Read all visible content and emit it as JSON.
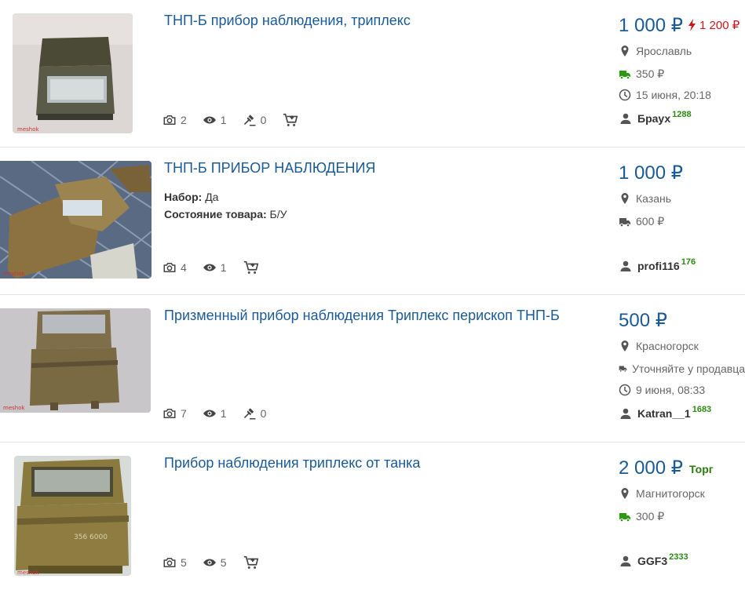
{
  "colors": {
    "link": "#1a5a96",
    "blitz": "#c8161d",
    "rating": "#2b8a10",
    "delivery_green": "#2b9a10"
  },
  "listings": [
    {
      "title": "ТНП-Б прибор наблюдения, триплекс",
      "price": "1 000 ₽",
      "blitz_price": "1 200 ₽",
      "torg": "",
      "props": [],
      "photos": "2",
      "views": "1",
      "bids": "0",
      "has_bids": true,
      "has_cart": true,
      "city": "Ярославль",
      "delivery": "350 ₽",
      "delivery_colored": true,
      "date": "15 июня, 20:18",
      "seller": "Браух",
      "rating": "1288"
    },
    {
      "title": "ТНП-Б ПРИБОР НАБЛЮДЕНИЯ",
      "price": "1 000 ₽",
      "blitz_price": "",
      "torg": "",
      "props": [
        {
          "label": "Набор:",
          "value": "Да"
        },
        {
          "label": "Состояние товара:",
          "value": "Б/У"
        }
      ],
      "photos": "4",
      "views": "1",
      "bids": "",
      "has_bids": false,
      "has_cart": true,
      "city": "Казань",
      "delivery": "600 ₽",
      "delivery_colored": false,
      "date": "",
      "seller": "profi116",
      "rating": "176"
    },
    {
      "title": "Призменный прибор наблюдения Триплекс перископ ТНП-Б",
      "price": "500 ₽",
      "blitz_price": "",
      "torg": "",
      "props": [],
      "photos": "7",
      "views": "1",
      "bids": "0",
      "has_bids": true,
      "has_cart": false,
      "city": "Красногорск",
      "delivery": "Уточняйте у продавца",
      "delivery_colored": false,
      "date": "9 июня, 08:33",
      "seller": "Katran__1",
      "rating": "1683"
    },
    {
      "title": "Прибор наблюдения триплекс от танка",
      "price": "2 000 ₽",
      "blitz_price": "",
      "torg": "Торг",
      "props": [],
      "photos": "5",
      "views": "5",
      "bids": "",
      "has_bids": false,
      "has_cart": true,
      "city": "Магнитогорск",
      "delivery": "300 ₽",
      "delivery_colored": true,
      "date": "",
      "seller": "GGF3",
      "rating": "2333"
    }
  ]
}
